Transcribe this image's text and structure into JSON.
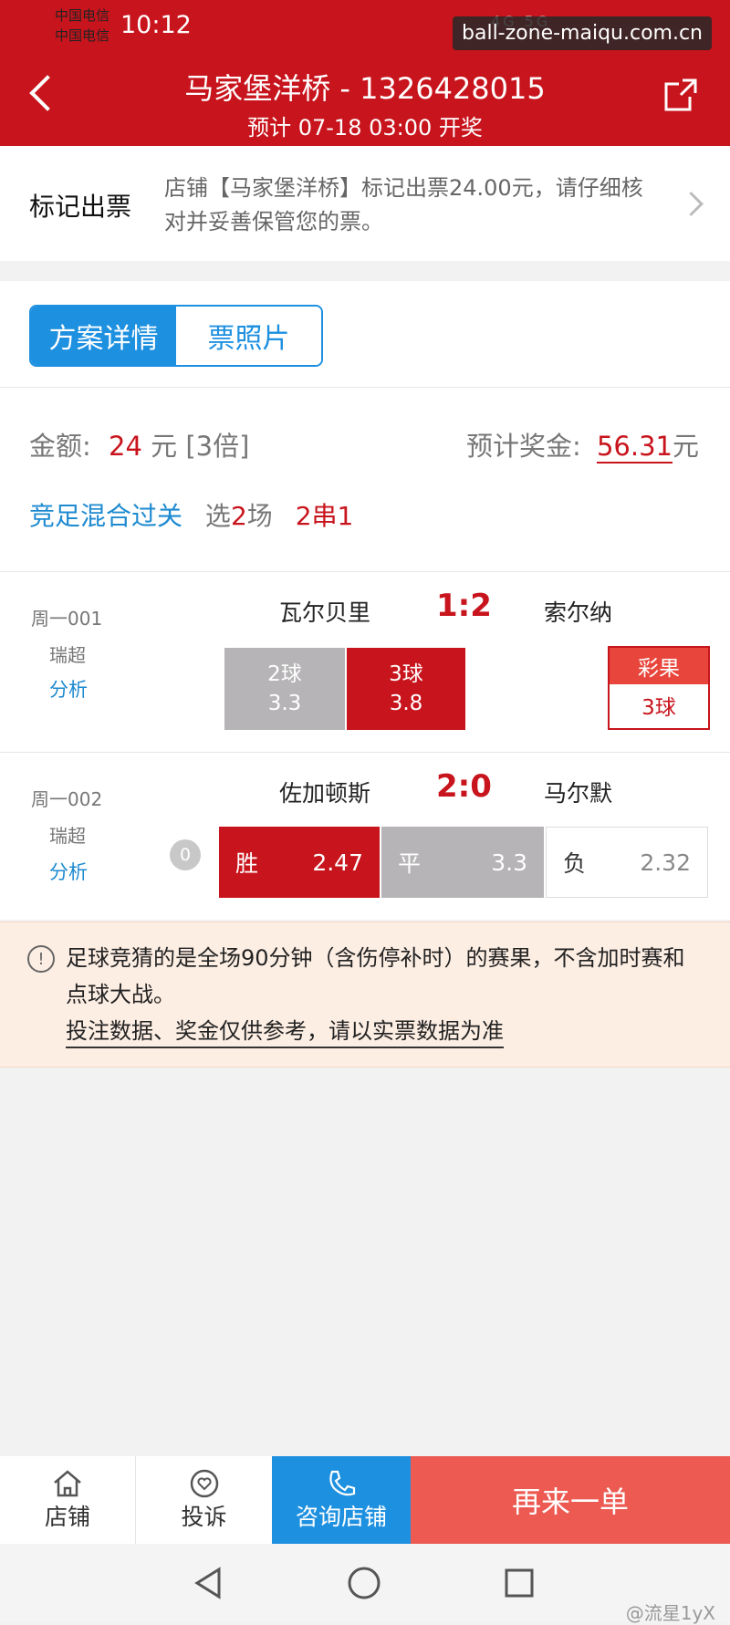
{
  "status": {
    "carrier1": "中国电信",
    "carrier2": "中国电信",
    "time": "10:12",
    "icons": "4G 5G"
  },
  "watermark": {
    "top": "ball-zone-maiqu.com.cn",
    "bottom": "@流星1yX"
  },
  "header": {
    "title": "马家堡洋桥 - 1326428015",
    "subtitle": "预计 07-18 03:00 开奖"
  },
  "notice": {
    "label": "标记出票",
    "text": "店铺【马家堡洋桥】标记出票24.00元，请仔细核对并妥善保管您的票。"
  },
  "tabs": [
    "方案详情",
    "票照片"
  ],
  "summary": {
    "amount_label": "金额:",
    "amount_value": "24",
    "amount_unit": "元 [3倍]",
    "prize_label": "预计奖金:",
    "prize_value": "56.31",
    "prize_unit": "元",
    "play_type": "竞足混合过关",
    "select_prefix": "选",
    "select_count": "2",
    "select_suffix": "场",
    "combo": "2串1"
  },
  "matches": [
    {
      "week": "周一001",
      "league": "瑞超",
      "analysis": "分析",
      "home": "瓦尔贝里",
      "score": "1:2",
      "away": "索尔纳",
      "options": [
        {
          "label": "2球",
          "odds": "3.3",
          "selected": false
        },
        {
          "label": "3球",
          "odds": "3.8",
          "selected": true
        }
      ],
      "result_label": "彩果",
      "result_value": "3球"
    },
    {
      "week": "周一002",
      "league": "瑞超",
      "analysis": "分析",
      "home": "佐加顿斯",
      "score": "2:0",
      "away": "马尔默",
      "handicap": "0",
      "options": [
        {
          "label": "胜",
          "odds": "2.47",
          "state": "selected"
        },
        {
          "label": "平",
          "odds": "3.3",
          "state": "picked"
        },
        {
          "label": "负",
          "odds": "2.32",
          "state": "none"
        }
      ]
    }
  ],
  "warning": {
    "text": "足球竞猜的是全场90分钟（含伤停补时）的赛果，不含加时赛和点球大战。",
    "link": "投注数据、奖金仅供参考，请以实票数据为准"
  },
  "bottom": {
    "shop": "店铺",
    "complain": "投诉",
    "consult": "咨询店铺",
    "again": "再来一单"
  },
  "colors": {
    "brand_red": "#c8141c",
    "blue": "#1e90e0",
    "grey": "#b6b4b6"
  }
}
